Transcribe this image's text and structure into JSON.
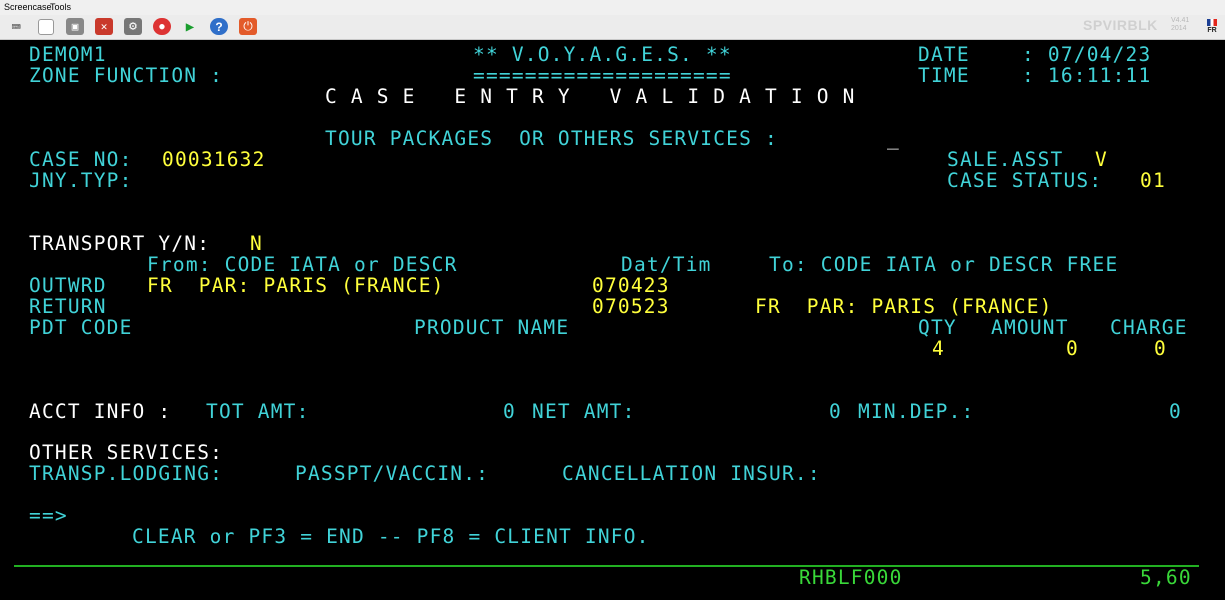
{
  "menubar": {
    "items": [
      "Screencase",
      "Tools"
    ]
  },
  "toolbar": {
    "buttons": [
      {
        "name": "keyboard-icon",
        "glyph": "⌨"
      },
      {
        "name": "new-session-icon",
        "glyph": "▯"
      },
      {
        "name": "print-screen-icon",
        "glyph": "▣"
      },
      {
        "name": "disconnect-icon",
        "glyph": "✕"
      },
      {
        "name": "settings-gear-icon",
        "glyph": "⚙"
      },
      {
        "name": "record-icon",
        "glyph": "●"
      },
      {
        "name": "play-icon",
        "glyph": "▶"
      },
      {
        "name": "help-icon",
        "glyph": "?"
      },
      {
        "name": "power-icon",
        "glyph": "⏻"
      }
    ],
    "brand": "SPVIRBLK",
    "version": "V4.41",
    "year": "2014",
    "language": "FR"
  },
  "screen": {
    "system_id": "DEMOM1",
    "zone_function_label": "ZONE FUNCTION :",
    "app_title": "** V.O.Y.A.G.E.S. **",
    "title_underline": "====================",
    "date_label": "DATE",
    "date_value": ": 07/04/23",
    "time_label": "TIME",
    "time_value": ": 16:11:11",
    "screen_title": "C A S E   E N T R Y   V A L I D A T I O N",
    "tour_prompt": "TOUR PACKAGES  OR OTHERS SERVICES :",
    "tour_input": "_",
    "case_no_label": "CASE NO:",
    "case_no_value": "00031632",
    "sale_asst_label": "SALE.ASST",
    "sale_asst_value": "V",
    "jny_typ_label": "JNY.TYP:",
    "case_status_label": "CASE STATUS:",
    "case_status_value": "01",
    "transport_label": "TRANSPORT Y/N:",
    "transport_value": "N",
    "from_header": "From: CODE IATA or DESCR",
    "dattim_header": "Dat/Tim",
    "to_header": "To: CODE IATA or DESCR FREE",
    "outward_label": "OUTWRD",
    "outward_from": "FR  PAR: PARIS (FRANCE)",
    "outward_date": "070423",
    "return_label": "RETURN",
    "return_date": "070523",
    "return_to": "FR  PAR: PARIS (FRANCE)",
    "pdt_code_header": "PDT CODE",
    "product_name_header": "PRODUCT NAME",
    "qty_header": "QTY",
    "amount_header": "AMOUNT",
    "charge_header": "CHARGE",
    "qty_value": "4",
    "amount_value": "0",
    "charge_value": "0",
    "acct_info_label": "ACCT INFO :",
    "tot_amt_label": "TOT AMT:",
    "tot_amt_value": "0",
    "net_amt_label": "NET AMT:",
    "net_amt_value": "0",
    "min_dep_label": "MIN.DEP.:",
    "min_dep_value": "0",
    "other_services_label": "OTHER SERVICES:",
    "transp_lodging_label": "TRANSP.LODGING:",
    "passpt_label": "PASSPT/VACCIN.:",
    "cancellation_label": "CANCELLATION INSUR.:",
    "command_prompt": "==>",
    "command_value": "",
    "help_line": "CLEAR or PF3 = END -- PF8 = CLIENT INFO.",
    "status_program": "RHBLF000",
    "cursor_position": "5,60"
  },
  "colors": {
    "background": "#000000",
    "field_label": "#41d3d8",
    "field_value": "#ffff3c",
    "heading": "#ffffff",
    "status_line": "#39d839"
  }
}
